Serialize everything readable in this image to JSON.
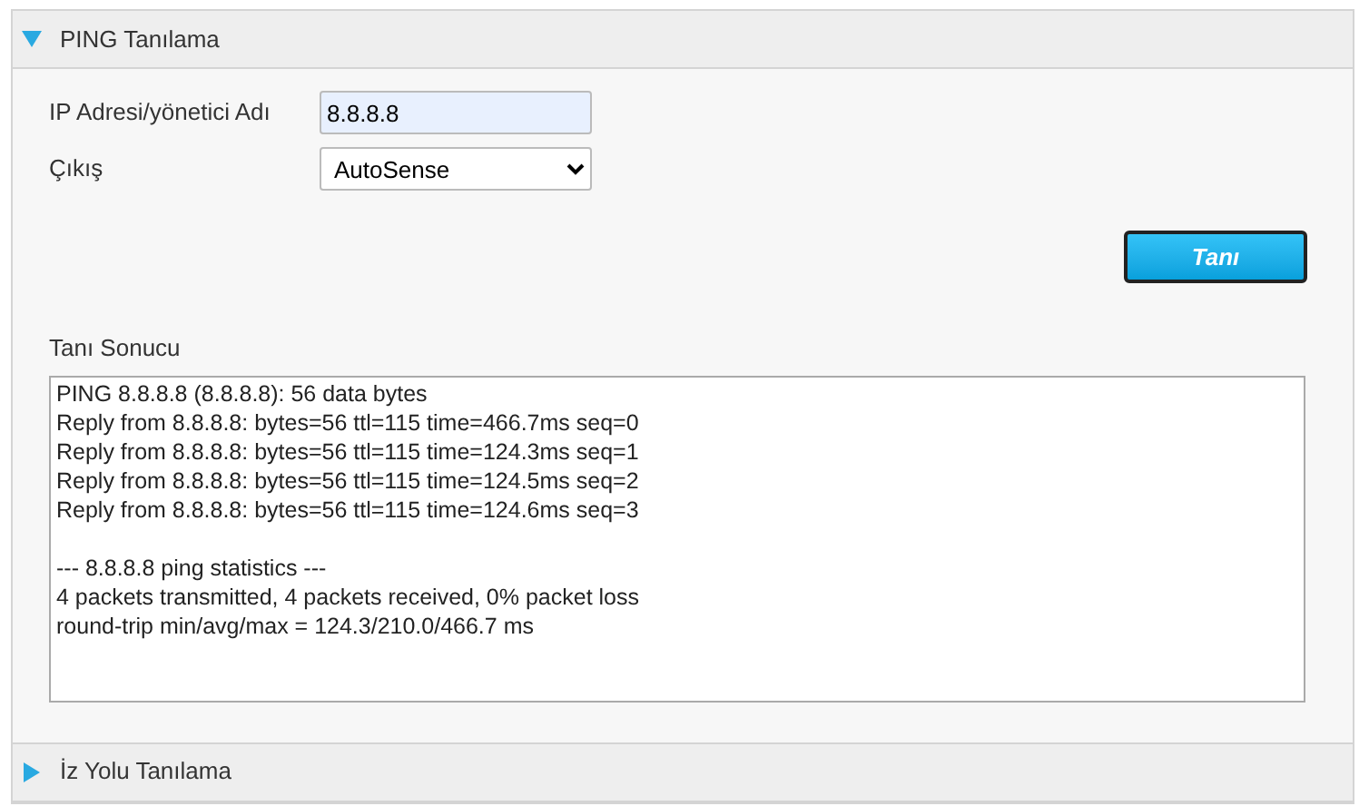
{
  "sections": [
    {
      "title": "PING Tanılama",
      "expanded": true
    },
    {
      "title": "İz Yolu Tanılama",
      "expanded": false
    }
  ],
  "form": {
    "ip_label": "IP Adresi/yönetici Adı",
    "ip_value": "8.8.8.8",
    "exit_label": "Çıkış",
    "exit_value": "AutoSense"
  },
  "button": "Tanı",
  "result": {
    "label": "Tanı Sonucu",
    "output": "PING 8.8.8.8 (8.8.8.8): 56 data bytes\nReply from 8.8.8.8: bytes=56 ttl=115 time=466.7ms seq=0\nReply from 8.8.8.8: bytes=56 ttl=115 time=124.3ms seq=1\nReply from 8.8.8.8: bytes=56 ttl=115 time=124.5ms seq=2\nReply from 8.8.8.8: bytes=56 ttl=115 time=124.6ms seq=3\n\n--- 8.8.8.8 ping statistics ---\n4 packets transmitted, 4 packets received, 0% packet loss\nround-trip min/avg/max = 124.3/210.0/466.7 ms"
  }
}
